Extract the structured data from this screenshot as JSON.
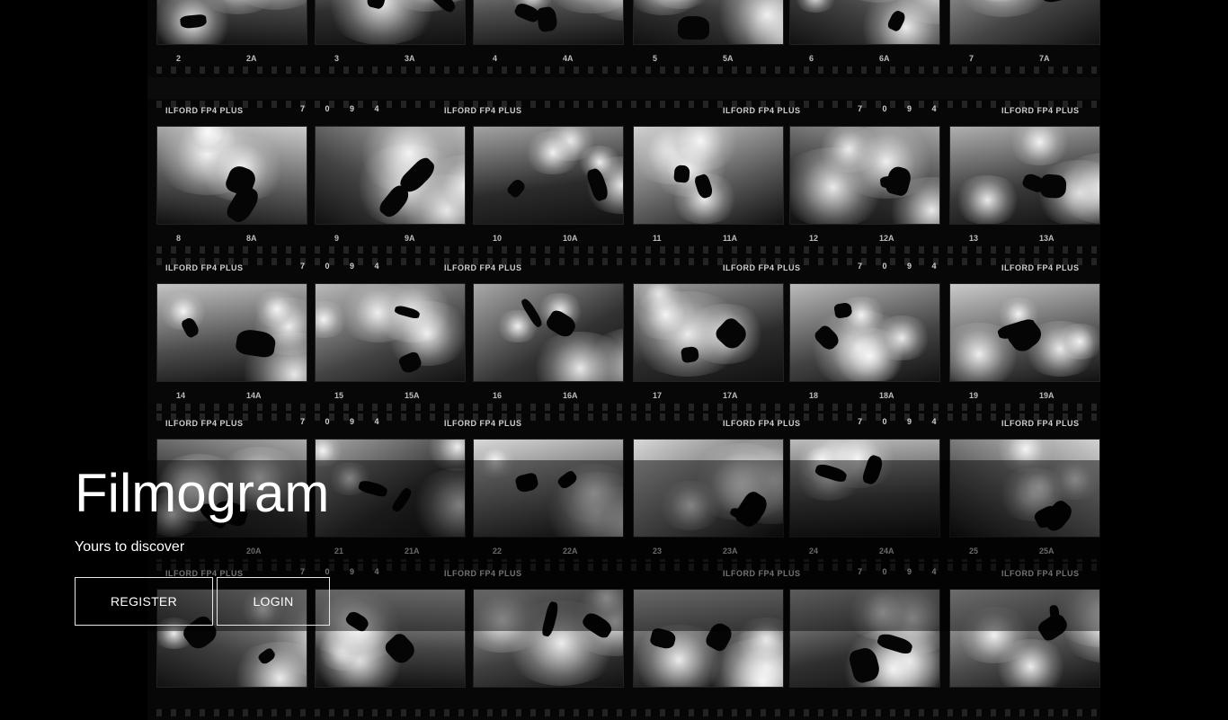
{
  "app": {
    "title": "Filmogram",
    "tagline": "Yours to discover"
  },
  "actions": {
    "register_label": "REGISTER",
    "login_label": "LOGIN"
  },
  "contact_sheet": {
    "film_brand": "ILFORD FP4 PLUS",
    "edge_code": "7 0 9 4",
    "rows": [
      [
        "2",
        "2A",
        "3",
        "3A",
        "4",
        "4A",
        "5",
        "5A",
        "6",
        "6A",
        "7",
        "7A"
      ],
      [
        "8",
        "8A",
        "9",
        "9A",
        "10",
        "10A",
        "11",
        "11A",
        "12",
        "12A",
        "13",
        "13A"
      ],
      [
        "14",
        "14A",
        "15",
        "15A",
        "16",
        "16A",
        "17",
        "17A",
        "18",
        "18A",
        "19",
        "19A"
      ],
      [
        "20A",
        "21",
        "21A",
        "22",
        "22A",
        "23",
        "23A",
        "24",
        "24A",
        "25",
        "25A"
      ]
    ]
  }
}
